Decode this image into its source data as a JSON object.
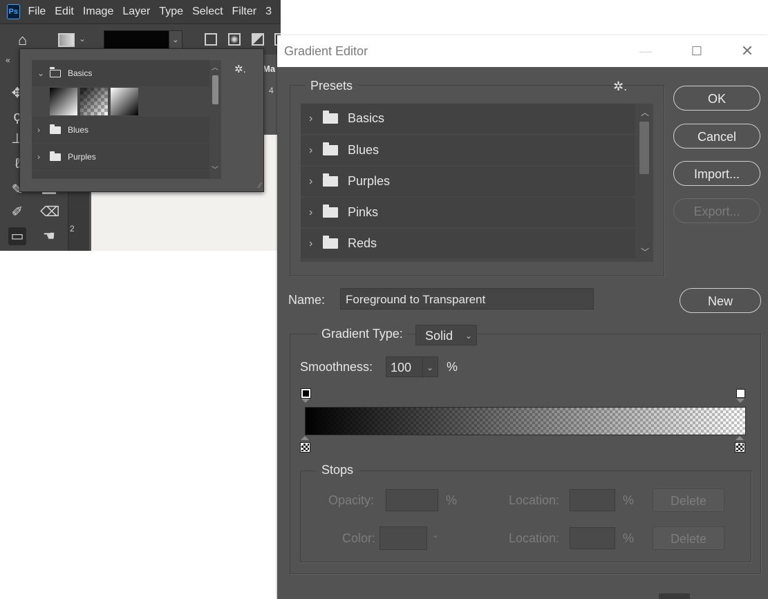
{
  "ps": {
    "menu": [
      "File",
      "Edit",
      "Image",
      "Layer",
      "Type",
      "Select",
      "Filter",
      "3"
    ],
    "logo": "Ps",
    "ruler_numbers": [
      "4",
      "2"
    ],
    "side_label": "Ma",
    "popup": {
      "folders": [
        {
          "label": "Basics",
          "expanded": true
        },
        {
          "label": "Blues",
          "expanded": false
        },
        {
          "label": "Purples",
          "expanded": false
        }
      ]
    }
  },
  "dialog": {
    "title": "Gradient Editor",
    "presets_label": "Presets",
    "preset_folders": [
      "Basics",
      "Blues",
      "Purples",
      "Pinks",
      "Reds"
    ],
    "buttons": {
      "ok": "OK",
      "cancel": "Cancel",
      "import": "Import...",
      "export": "Export...",
      "new": "New"
    },
    "name_label": "Name:",
    "name_value": "Foreground to Transparent",
    "gradient_type_label": "Gradient Type:",
    "gradient_type_value": "Solid",
    "smoothness_label": "Smoothness:",
    "smoothness_value": "100",
    "percent": "%",
    "stops": {
      "label": "Stops",
      "opacity_label": "Opacity:",
      "color_label": "Color:",
      "location_label": "Location:",
      "delete_label": "Delete"
    },
    "gradient": {
      "start_color": "#000000",
      "end_color": "transparent"
    }
  }
}
